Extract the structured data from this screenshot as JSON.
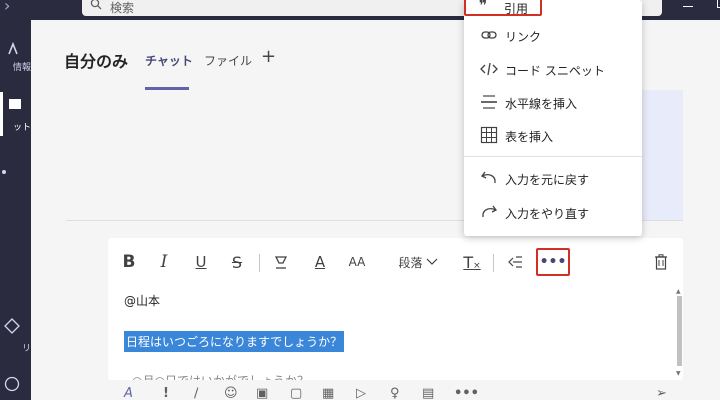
{
  "search": {
    "placeholder": "検索"
  },
  "rail": {
    "items": [
      {
        "label": "情報"
      },
      {
        "label": "ット"
      },
      {
        "label": "リ"
      }
    ]
  },
  "header": {
    "title": "自分のみ",
    "tabs": [
      {
        "label": "チャット",
        "active": true
      },
      {
        "label": "ファイル",
        "active": false
      }
    ],
    "add_tab": "+"
  },
  "toolbar": {
    "bold": "B",
    "italic": "I",
    "underline": "U",
    "strike": "S",
    "font_color": "A",
    "font_size": "AA",
    "paragraph": "段落",
    "clear_format": "T",
    "more": "•••"
  },
  "compose": {
    "mention": "@山本",
    "selected_text": "日程はいつごろになりますでしょうか？",
    "partial_text": "○月○日ではいかがでしょうか？"
  },
  "menu": {
    "items": [
      {
        "label": "引用",
        "icon": "quote-icon"
      },
      {
        "label": "リンク",
        "icon": "link-icon"
      },
      {
        "label": "コード スニペット",
        "icon": "code-icon"
      },
      {
        "label": "水平線を挿入",
        "icon": "horizontal-rule-icon"
      },
      {
        "label": "表を挿入",
        "icon": "table-icon"
      },
      {
        "label": "入力を元に戻す",
        "icon": "undo-icon"
      },
      {
        "label": "入力をやり直す",
        "icon": "redo-icon"
      }
    ]
  },
  "colors": {
    "rail": "#2b2b40",
    "accent": "#6264a7",
    "highlight_box": "#d22f27",
    "selection": "#3a86d9"
  }
}
